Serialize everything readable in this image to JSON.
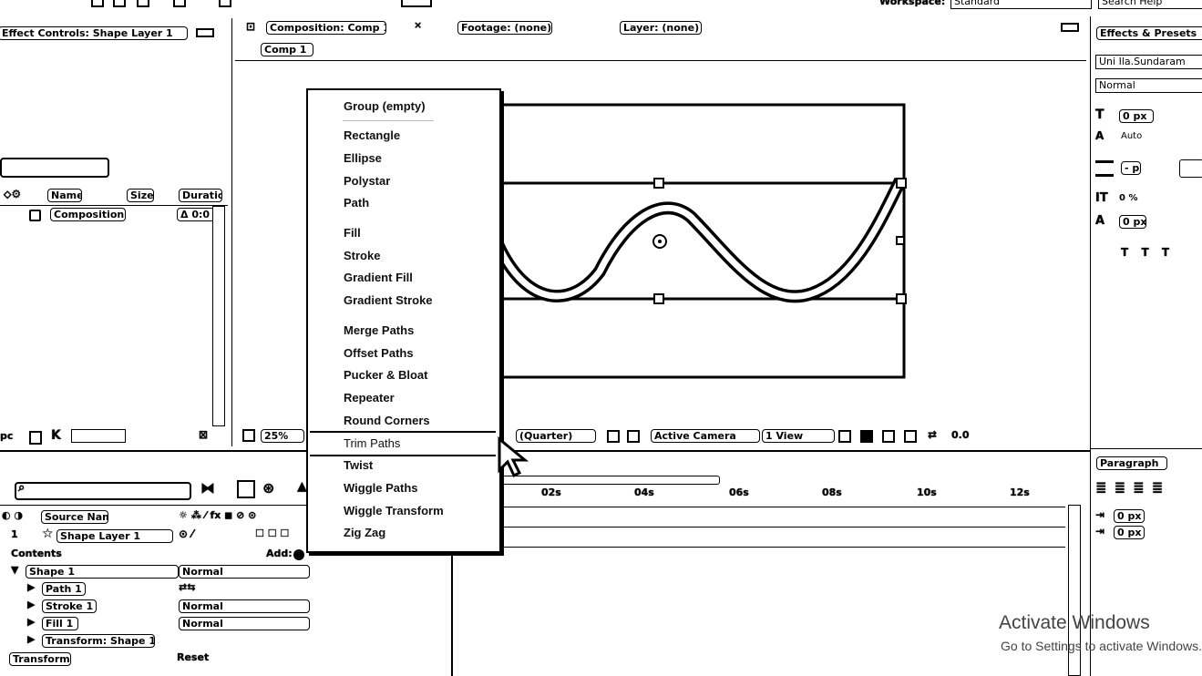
{
  "top": {
    "workspace_label": "Workspace:",
    "workspace_value": "Standard",
    "search_label": "Search Help"
  },
  "effect_controls": {
    "title": "Effect Controls: Shape Layer 1"
  },
  "project": {
    "columns": {
      "name": "Name",
      "size": "Size",
      "duration": "Duration"
    },
    "item_name": "Composition",
    "item_duration": "Δ 0:0"
  },
  "viewer": {
    "tab_composition": "Composition: Comp 1",
    "tab_footage": "Footage: (none)",
    "tab_layer": "Layer: (none)",
    "comp_pill": "Comp 1",
    "footer_zoom": "25%",
    "footer_res": "(Quarter)",
    "footer_camera": "Active Camera",
    "footer_view": "1 View"
  },
  "shape_menu": {
    "items": [
      "Group (empty)",
      "Rectangle",
      "Ellipse",
      "Polystar",
      "Path",
      "Fill",
      "Stroke",
      "Gradient Fill",
      "Gradient Stroke",
      "Merge Paths",
      "Offset Paths",
      "Pucker & Bloat",
      "Repeater",
      "Round Corners",
      "Trim Paths",
      "Twist",
      "Wiggle Paths",
      "Wiggle Transform",
      "Zig Zag"
    ],
    "highlighted": "Trim Paths"
  },
  "timeline": {
    "source_name_header": "Source Name",
    "layer_name": "Shape Layer 1",
    "contents_label": "Contents",
    "add_label": "Add:",
    "rows": [
      {
        "label": "Shape 1",
        "blend": "Normal"
      },
      {
        "label": "Path 1",
        "blend": ""
      },
      {
        "label": "Stroke 1",
        "blend": "Normal"
      },
      {
        "label": "Fill 1",
        "blend": "Normal"
      },
      {
        "label": "Transform: Shape 1",
        "blend": ""
      }
    ],
    "transform_label": "Transform",
    "reset_label": "Reset",
    "ruler": [
      "02s",
      "04s",
      "06s",
      "08s",
      "10s",
      "12s"
    ]
  },
  "character": {
    "title": "Effects & Presets",
    "font_name": "Uni Ila.Sundaram",
    "font_style": "Normal",
    "size_value": "0 px",
    "leading": "Auto",
    "stroke_px": "- px",
    "tsume": "0 %",
    "baseline": "0 px"
  },
  "paragraph": {
    "title": "Paragraph",
    "indent1": "0 px",
    "indent2": "0 px"
  },
  "watermark": {
    "line1": "Activate Windows",
    "line2": "Go to Settings to activate Windows."
  }
}
